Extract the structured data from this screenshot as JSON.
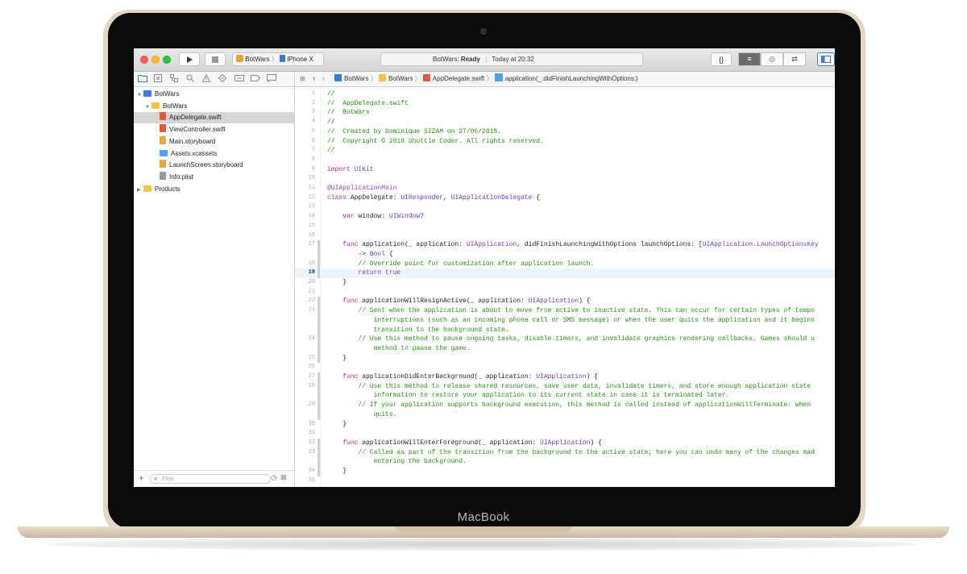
{
  "device": {
    "brand_label": "MacBook"
  },
  "toolbar": {
    "scheme_target": "BotWars",
    "scheme_device": "iPhone X",
    "status_prefix": "BotWars: ",
    "status_state": "Ready",
    "status_time": "Today at 20:32",
    "editor_mode_icons": [
      "{}",
      "≡",
      "◎",
      "⇄"
    ]
  },
  "navigator_icons": [
    "folder-icon",
    "source-control-icon",
    "symbol-icon",
    "find-icon",
    "issue-icon",
    "test-icon",
    "debug-icon",
    "breakpoint-icon",
    "report-icon"
  ],
  "jumpbar": {
    "items": [
      "BotWars",
      "BotWars",
      "AppDelegate.swift",
      "application(_:didFinishLaunchingWithOptions:)"
    ]
  },
  "sidebar": {
    "items": [
      {
        "label": "BotWars",
        "kind": "project",
        "indent": 0,
        "disclosure": "▼"
      },
      {
        "label": "BotWars",
        "kind": "folder",
        "indent": 1,
        "disclosure": "▼"
      },
      {
        "label": "AppDelegate.swift",
        "kind": "swift",
        "indent": 2,
        "selected": true
      },
      {
        "label": "ViewController.swift",
        "kind": "swift",
        "indent": 2
      },
      {
        "label": "Main.storyboard",
        "kind": "storyboard",
        "indent": 2
      },
      {
        "label": "Assets.xcassets",
        "kind": "assets",
        "indent": 2
      },
      {
        "label": "LaunchScreen.storyboard",
        "kind": "storyboard",
        "indent": 2
      },
      {
        "label": "Info.plist",
        "kind": "plist",
        "indent": 2
      },
      {
        "label": "Products",
        "kind": "folder",
        "indent": 0,
        "disclosure": "▶"
      }
    ],
    "filter_placeholder": "Filter"
  },
  "code": {
    "highlighted_line": 19,
    "lines": [
      {
        "n": "1",
        "text": "//",
        "c": "comment"
      },
      {
        "n": "2",
        "text": "//  AppDelegate.swift",
        "c": "comment"
      },
      {
        "n": "3",
        "text": "//  BotWars",
        "c": "comment"
      },
      {
        "n": "4",
        "text": "//",
        "c": "comment"
      },
      {
        "n": "5",
        "text": "//  Created by Dominique SIZAM on 27/06/2018.",
        "c": "comment"
      },
      {
        "n": "6",
        "text": "//  Copyright © 2018 Shuttle Coder. All rights reserved.",
        "c": "comment"
      },
      {
        "n": "7",
        "text": "//",
        "c": "comment"
      },
      {
        "n": "8",
        "text": "",
        "c": "plain"
      },
      {
        "n": "9",
        "text": "import UIKit",
        "c": "import"
      },
      {
        "n": "10",
        "text": "",
        "c": "plain"
      },
      {
        "n": "11",
        "text": "@UIApplicationMain",
        "c": "attr"
      },
      {
        "n": "12",
        "text": "class AppDelegate: UIResponder, UIApplicationDelegate {",
        "c": "classdecl"
      },
      {
        "n": "13",
        "text": "",
        "c": "plain"
      },
      {
        "n": "14",
        "text": "    var window: UIWindow?",
        "c": "var"
      },
      {
        "n": "15",
        "text": "",
        "c": "plain"
      },
      {
        "n": "16",
        "text": "",
        "c": "plain"
      },
      {
        "n": "17",
        "text": "    func application(_ application: UIApplication, didFinishLaunchingWithOptions launchOptions: [UIApplication.LaunchOptionsKey",
        "c": "func"
      },
      {
        "n": "",
        "text": "        -> Bool {",
        "c": "bool"
      },
      {
        "n": "18",
        "text": "        // Override point for customization after application launch.",
        "c": "comment"
      },
      {
        "n": "19",
        "text": "        return true",
        "c": "keyword"
      },
      {
        "n": "20",
        "text": "    }",
        "c": "plain"
      },
      {
        "n": "21",
        "text": "",
        "c": "plain"
      },
      {
        "n": "22",
        "text": "    func applicationWillResignActive(_ application: UIApplication) {",
        "c": "func"
      },
      {
        "n": "23",
        "text": "        // Sent when the application is about to move from active to inactive state. This can occur for certain types of tempo",
        "c": "comment"
      },
      {
        "n": "",
        "text": "            interruptions (such as an incoming phone call or SMS message) or when the user quits the application and it begins",
        "c": "comment"
      },
      {
        "n": "",
        "text": "            transition to the background state.",
        "c": "comment"
      },
      {
        "n": "24",
        "text": "        // Use this method to pause ongoing tasks, disable timers, and invalidate graphics rendering callbacks. Games should u",
        "c": "comment"
      },
      {
        "n": "",
        "text": "            method to pause the game.",
        "c": "comment"
      },
      {
        "n": "25",
        "text": "    }",
        "c": "plain"
      },
      {
        "n": "26",
        "text": "",
        "c": "plain"
      },
      {
        "n": "27",
        "text": "    func applicationDidEnterBackground(_ application: UIApplication) {",
        "c": "func"
      },
      {
        "n": "28",
        "text": "        // Use this method to release shared resources, save user data, invalidate timers, and store enough application state",
        "c": "comment"
      },
      {
        "n": "",
        "text": "            information to restore your application to its current state in case it is terminated later.",
        "c": "comment"
      },
      {
        "n": "29",
        "text": "        // If your application supports background execution, this method is called instead of applicationWillTerminate: when",
        "c": "comment"
      },
      {
        "n": "",
        "text": "            quits.",
        "c": "comment"
      },
      {
        "n": "30",
        "text": "    }",
        "c": "plain"
      },
      {
        "n": "31",
        "text": "",
        "c": "plain"
      },
      {
        "n": "32",
        "text": "    func applicationWillEnterForeground(_ application: UIApplication) {",
        "c": "func"
      },
      {
        "n": "33",
        "text": "        // Called as part of the transition from the background to the active state; here you can undo many of the changes mad",
        "c": "comment"
      },
      {
        "n": "",
        "text": "            entering the background.",
        "c": "comment"
      },
      {
        "n": "34",
        "text": "    }",
        "c": "plain"
      },
      {
        "n": "35",
        "text": "",
        "c": "plain"
      }
    ]
  },
  "colors": {
    "comment": "#2f8a1d",
    "keyword": "#ab2ea0",
    "type": "#6e3ec2",
    "attr": "#8a4dbb",
    "plain": "#262626",
    "selection": "#d5d5d5",
    "line_highlight": "#ebf3fc",
    "folder": "#f5c542",
    "swift": "#e8573c",
    "assets": "#4ba3f0"
  }
}
